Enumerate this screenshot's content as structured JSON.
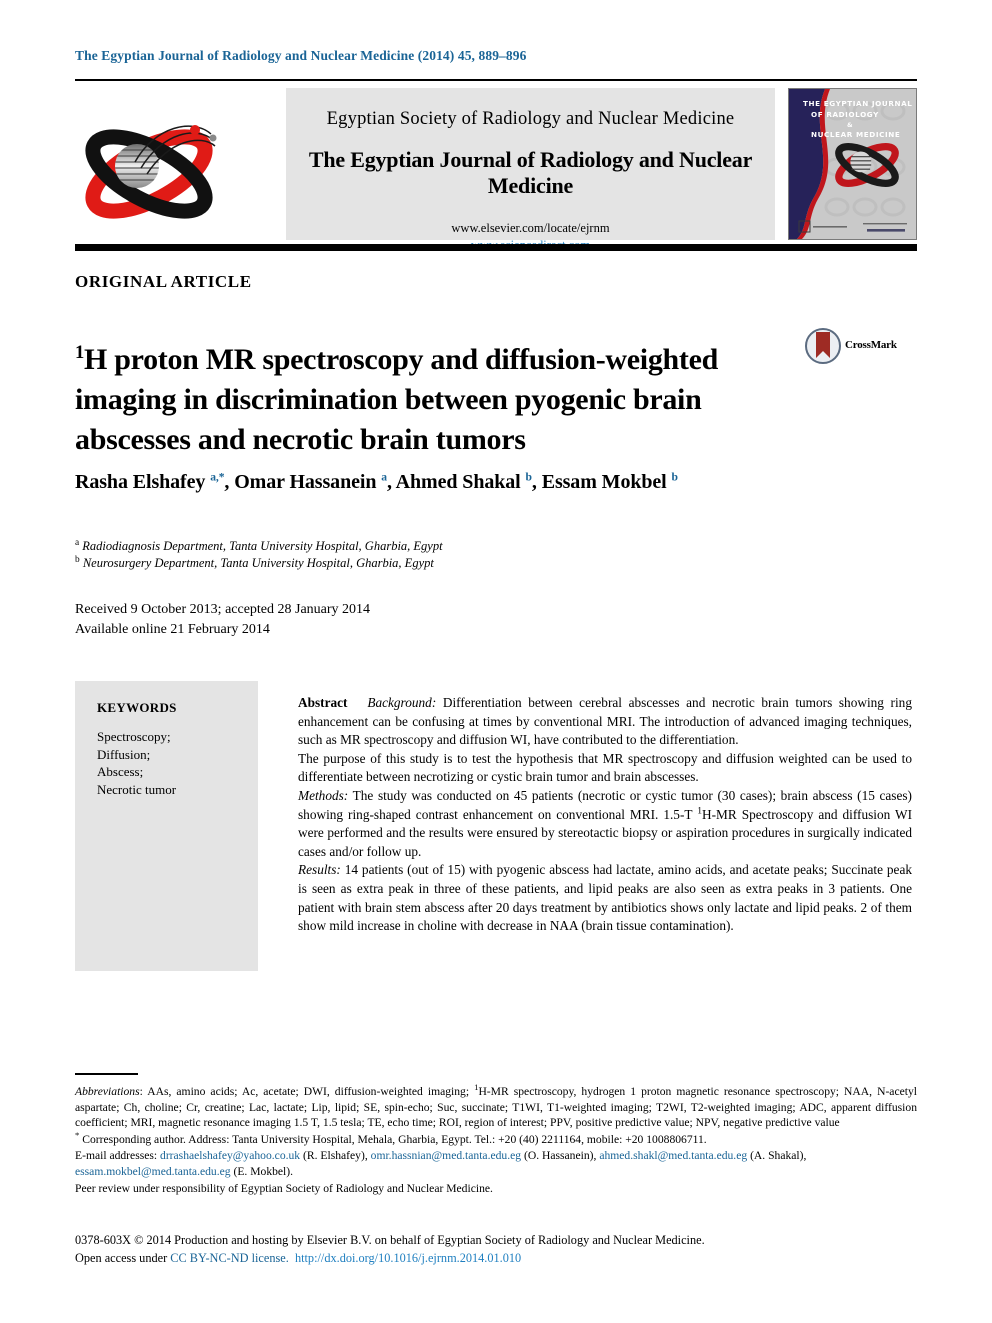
{
  "running_head": "The Egyptian Journal of Radiology and Nuclear Medicine (2014) 45, 889–896",
  "masthead": {
    "society_name": "Egyptian Society of Radiology and Nuclear Medicine",
    "journal_name": "The Egyptian Journal of Radiology and Nuclear Medicine",
    "elsevier_url": "www.elsevier.com/locate/ejrnm",
    "sciencedirect_url": "www.sciencedirect.com",
    "cover": {
      "line1": "THE EGYPTIAN JOURNAL",
      "line2": "OF RADIOLOGY",
      "line3": "&",
      "line4": "NUCLEAR MEDICINE"
    }
  },
  "article_type": "ORIGINAL ARTICLE",
  "title": {
    "sup": "1",
    "rest": "H proton MR spectroscopy and diffusion-weighted imaging in discrimination between pyogenic brain abscesses and necrotic brain tumors"
  },
  "crossmark": {
    "label": "CrossMark"
  },
  "authors": [
    {
      "name": "Rasha Elshafey",
      "marks": "a,*"
    },
    {
      "name": "Omar Hassanein",
      "marks": "a"
    },
    {
      "name": "Ahmed Shakal",
      "marks": "b"
    },
    {
      "name": "Essam Mokbel",
      "marks": "b"
    }
  ],
  "affiliations": [
    {
      "mark": "a",
      "text": "Radiodiagnosis Department, Tanta University Hospital, Gharbia, Egypt"
    },
    {
      "mark": "b",
      "text": "Neurosurgery Department, Tanta University Hospital, Gharbia, Egypt"
    }
  ],
  "dates": {
    "received": "Received 9 October 2013; accepted 28 January 2014",
    "available": "Available online 21 February 2014"
  },
  "keywords": {
    "heading": "KEYWORDS",
    "items": [
      "Spectroscopy;",
      "Diffusion;",
      "Abscess;",
      "Necrotic tumor"
    ]
  },
  "abstract": {
    "label": "Abstract",
    "background_label": "Background:",
    "background_text": " Differentiation between cerebral abscesses and necrotic brain tumors showing ring enhancement can be confusing at times by conventional MRI. The introduction of advanced imaging techniques, such as MR spectroscopy and diffusion WI, have contributed to the differentiation.",
    "purpose_text": "The purpose of this study is to test the hypothesis that MR spectroscopy and diffusion weighted can be used to differentiate between necrotizing or cystic brain tumor and brain abscesses.",
    "methods_label": "Methods:",
    "methods_text_a": " The study was conducted on 45 patients (necrotic or cystic tumor (30 cases); brain abscess (15 cases) showing ring-shaped contrast enhancement on conventional MRI. 1.5-T ",
    "methods_sup": "1",
    "methods_text_b": "H-MR Spectroscopy and diffusion WI were performed and the results were ensured by stereotactic biopsy or aspiration procedures in surgically indicated cases and/or follow up.",
    "results_label": "Results:",
    "results_text": "  14 patients (out of 15) with pyogenic abscess had lactate, amino acids, and acetate peaks; Succinate peak is seen as extra peak in three of these patients, and lipid peaks are also seen as extra peaks in 3 patients. One patient with brain stem abscess after 20 days treatment by antibiotics shows only lactate and lipid peaks. 2 of them show mild increase in choline with decrease in NAA (brain tissue contamination)."
  },
  "footnotes": {
    "abbr_label": "Abbreviations",
    "abbr_text_a": ": AAs, amino acids; Ac, acetate; DWI, diffusion-weighted imaging; ",
    "abbr_sup": "1",
    "abbr_text_b": "H-MR spectroscopy, hydrogen 1 proton magnetic resonance spectroscopy; NAA, N-acetyl aspartate; Ch, choline; Cr, creatine; Lac, lactate; Lip, lipid; SE, spin-echo; Suc, succinate; T1WI, T1-weighted imaging; T2WI, T2-weighted imaging; ADC, apparent diffusion coefficient; MRI, magnetic resonance imaging 1.5 T, 1.5 tesla; TE, echo time; ROI, region of interest; PPV, positive predictive value; NPV, negative predictive value",
    "corresponding": "Corresponding author. Address: Tanta University Hospital, Mehala, Gharbia, Egypt. Tel.: +20 (40) 2211164, mobile: +20 1008806711.",
    "email_label": "E-mail addresses:",
    "emails": [
      {
        "address": "drrashaelshafey@yahoo.co.uk",
        "owner": "(R. Elshafey),"
      },
      {
        "address": "omr.hassnian@med.tanta.edu.eg",
        "owner": "(O. Hassanein),"
      },
      {
        "address": "ahmed.shakl@med.tanta.edu.eg",
        "owner": "(A. Shakal),"
      },
      {
        "address": "essam.mokbel@med.tanta.edu.eg",
        "owner": "(E. Mokbel)."
      }
    ],
    "peer_review": "Peer review under responsibility of Egyptian Society of Radiology and Nuclear Medicine."
  },
  "bottom": {
    "copyright": "0378-603X © 2014 Production and hosting by Elsevier B.V. on behalf of Egyptian Society of Radiology and Nuclear Medicine.",
    "open_access_prefix": "Open access under ",
    "license_text": "CC BY-NC-ND license.",
    "doi": "http://dx.doi.org/10.1016/j.ejrnm.2014.01.010"
  },
  "colors": {
    "link_blue": "#1a6496",
    "doi_blue": "#1f7fc0",
    "panel_gray": "#e4e4e4",
    "crossmark_red": "#9e2b24"
  }
}
